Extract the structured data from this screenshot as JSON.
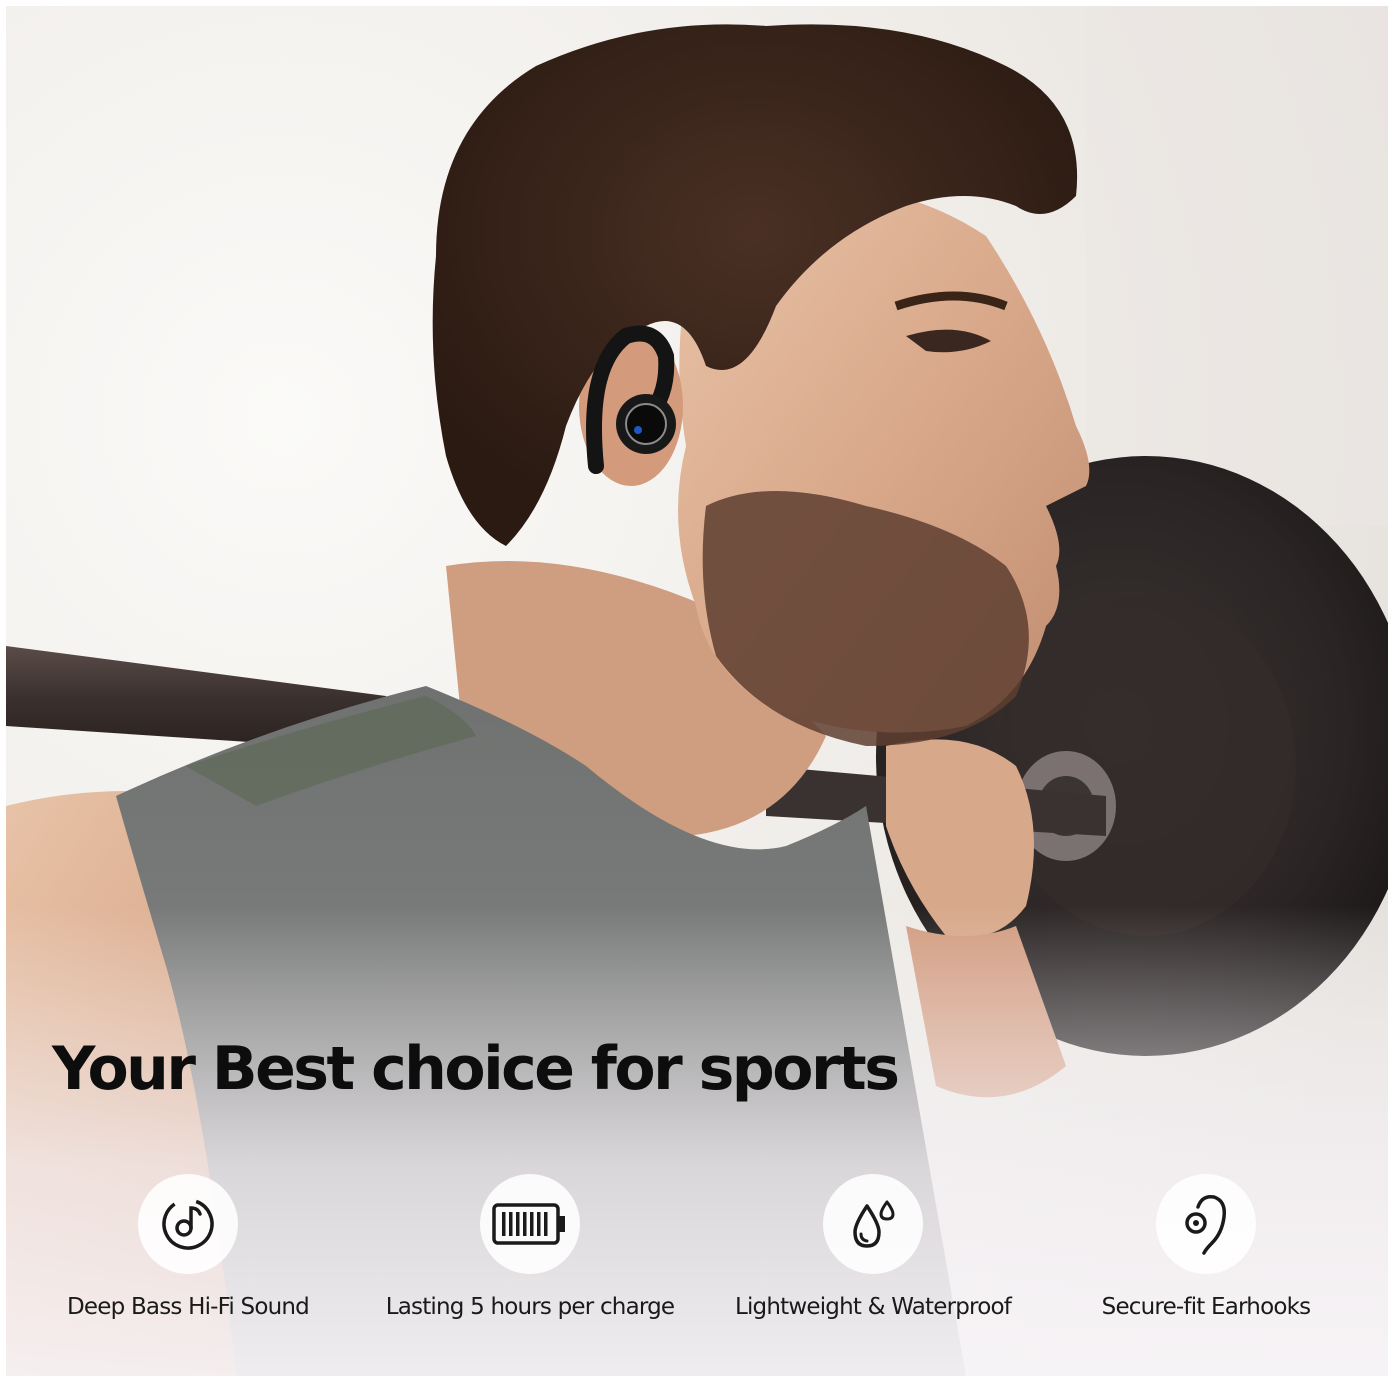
{
  "headline": "Your Best choice for sports",
  "features": [
    {
      "icon": "music-note-icon",
      "label": "Deep Bass Hi-Fi Sound"
    },
    {
      "icon": "battery-icon",
      "label": "Lasting 5 hours per charge"
    },
    {
      "icon": "water-drop-icon",
      "label": "Lightweight & Waterproof"
    },
    {
      "icon": "earhook-icon",
      "label": "Secure-fit Earhooks"
    }
  ],
  "colors": {
    "headline": "#0d0d0d",
    "label": "#1a1a1a",
    "icon_stroke": "#1a1a1a",
    "icon_bg": "#ffffff"
  }
}
